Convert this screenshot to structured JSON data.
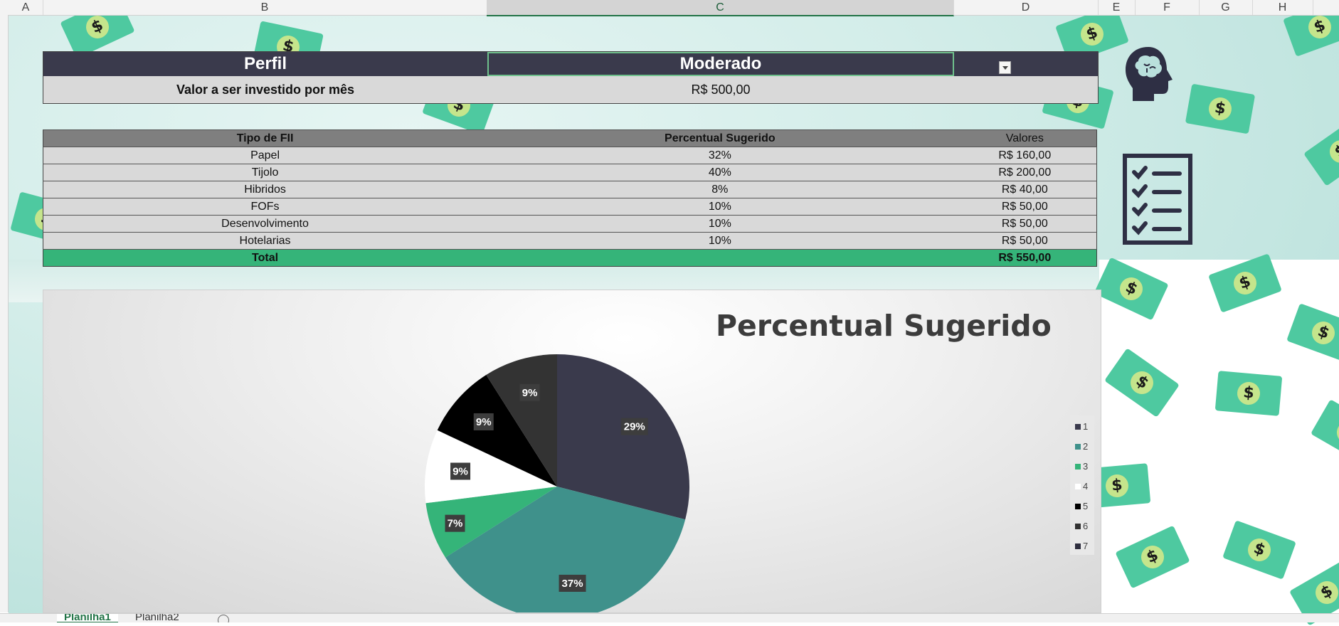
{
  "columns": [
    "A",
    "B",
    "C",
    "D",
    "E",
    "F",
    "G",
    "H"
  ],
  "selected_column": "C",
  "profile": {
    "label": "Perfil",
    "value": "Moderado"
  },
  "investment": {
    "label": "Valor a ser investido por mês",
    "value": "R$ 500,00"
  },
  "fii_table": {
    "headers": [
      "Tipo de FII",
      "Percentual Sugerido",
      "Valores"
    ],
    "rows": [
      {
        "tipo": "Papel",
        "percentual": "32%",
        "valor": "R$ 160,00"
      },
      {
        "tipo": "Tijolo",
        "percentual": "40%",
        "valor": "R$ 200,00"
      },
      {
        "tipo": "Hibridos",
        "percentual": "8%",
        "valor": "R$ 40,00"
      },
      {
        "tipo": "FOFs",
        "percentual": "10%",
        "valor": "R$ 50,00"
      },
      {
        "tipo": "Desenvolvimento",
        "percentual": "10%",
        "valor": "R$ 50,00"
      },
      {
        "tipo": "Hotelarias",
        "percentual": "10%",
        "valor": "R$ 50,00"
      }
    ],
    "total": {
      "label": "Total",
      "valor": "R$ 550,00"
    }
  },
  "chart_data": {
    "type": "pie",
    "title": "Percentual Sugerido",
    "legend_position": "right",
    "categories": [
      "1",
      "2",
      "3",
      "4",
      "5",
      "6",
      "7"
    ],
    "values": [
      29,
      37,
      7,
      9,
      9,
      9,
      0
    ],
    "labels": [
      "29%",
      "37%",
      "7%",
      "9%",
      "9%",
      "9%",
      ""
    ],
    "colors": [
      "#3a3a4c",
      "#3f918b",
      "#35b479",
      "#ffffff",
      "#000000",
      "#333333",
      "#2e2e3e"
    ]
  },
  "sheets": [
    {
      "name": "Planilha1",
      "active": true
    },
    {
      "name": "Planilha2",
      "active": false
    }
  ],
  "icons": {
    "head": "brain-head-icon",
    "checklist": "checklist-icon",
    "money": "money-bill-icon",
    "add_sheet": "add-sheet-icon"
  }
}
